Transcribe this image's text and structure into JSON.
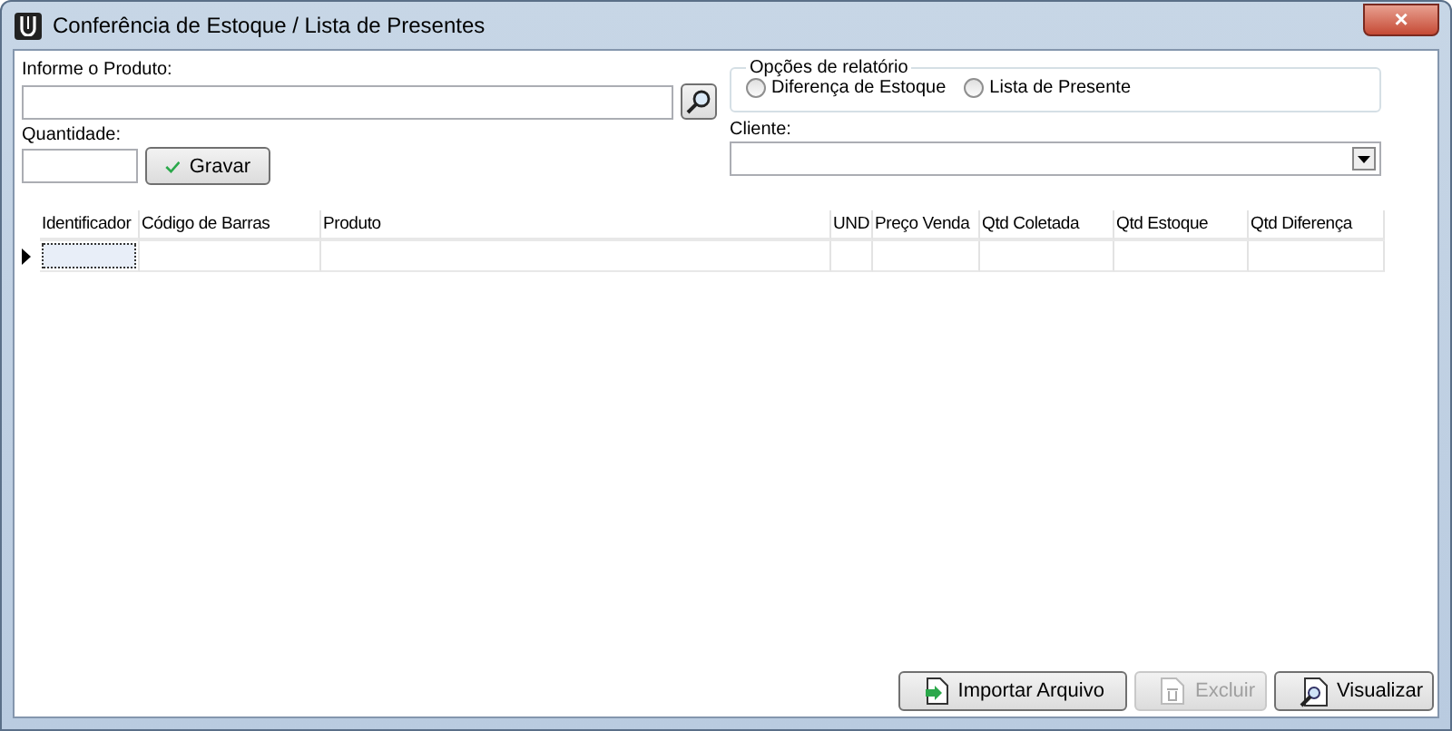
{
  "window": {
    "title": "Conferência de Estoque / Lista de Presentes",
    "close": "×"
  },
  "product": {
    "label": "Informe o Produto:"
  },
  "quantity": {
    "label": "Quantidade:",
    "button": "Gravar"
  },
  "report_options": {
    "title": "Opções de relatório",
    "options": [
      {
        "label": "Diferença de Estoque",
        "selected": false
      },
      {
        "label": "Lista de Presente",
        "selected": false
      }
    ]
  },
  "client": {
    "label": "Cliente:"
  },
  "table": {
    "columns": [
      "Identificador",
      "Código de Barras",
      "Produto",
      "UND",
      "Preço Venda",
      "Qtd Coletada",
      "Qtd Estoque",
      "Qtd Diferença"
    ]
  },
  "buttons": [
    {
      "label": "Importar Arquivo",
      "kind": "import",
      "disabled": false
    },
    {
      "label": "Excluir",
      "kind": "delete",
      "disabled": true
    },
    {
      "label": "Visualizar",
      "kind": "preview",
      "disabled": false
    }
  ]
}
